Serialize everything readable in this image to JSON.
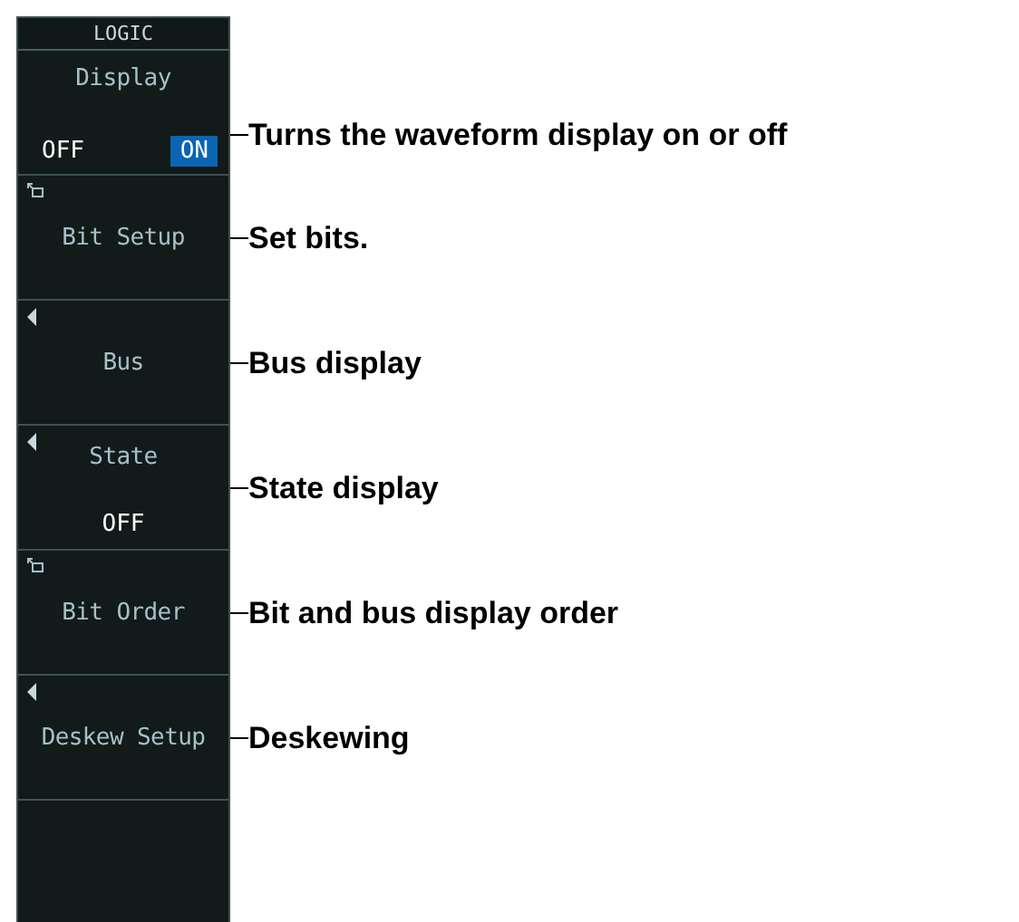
{
  "menu": {
    "title": "LOGIC",
    "items": [
      {
        "kind": "toggle",
        "label": "Display",
        "options": [
          {
            "label": "OFF",
            "selected": false
          },
          {
            "label": "ON",
            "selected": true
          }
        ],
        "note": "Turns the waveform display on or off"
      },
      {
        "kind": "dialog",
        "label": "Bit Setup",
        "note": "Set bits."
      },
      {
        "kind": "submenu",
        "label": "Bus",
        "note": "Bus display"
      },
      {
        "kind": "submenu",
        "label": "State",
        "value": "OFF",
        "note": "State display"
      },
      {
        "kind": "dialog",
        "label": "Bit Order",
        "note": "Bit and bus display order"
      },
      {
        "kind": "submenu",
        "label": "Deskew Setup",
        "note": "Deskewing"
      }
    ]
  }
}
